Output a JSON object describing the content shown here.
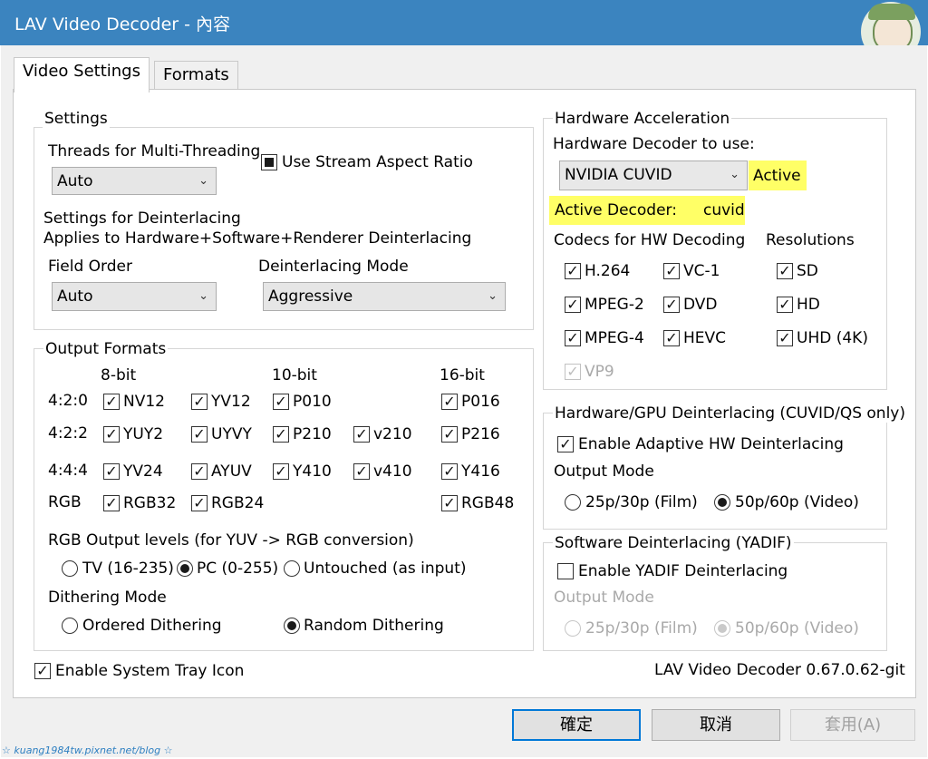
{
  "window": {
    "title": "LAV Video Decoder - 內容"
  },
  "tabs": [
    {
      "label": "Video Settings"
    },
    {
      "label": "Formats"
    }
  ],
  "settings": {
    "group_title": "Settings",
    "threads_label": "Threads for Multi-Threading",
    "threads_value": "Auto",
    "stream_aspect_label": "Use Stream Aspect Ratio",
    "deint_title": "Settings for Deinterlacing",
    "deint_desc": "Applies to Hardware+Software+Renderer Deinterlacing",
    "field_order_label": "Field Order",
    "field_order_value": "Auto",
    "deint_mode_label": "Deinterlacing Mode",
    "deint_mode_value": "Aggressive"
  },
  "output_formats": {
    "group_title": "Output Formats",
    "col_8bit": "8-bit",
    "col_10bit": "10-bit",
    "col_16bit": "16-bit",
    "rows": [
      "4:2:0",
      "4:2:2",
      "4:4:4",
      "RGB"
    ],
    "formats": {
      "nv12": "NV12",
      "yv12": "YV12",
      "p010": "P010",
      "p016": "P016",
      "yuy2": "YUY2",
      "uyvy": "UYVY",
      "p210": "P210",
      "v210": "v210",
      "p216": "P216",
      "yv24": "YV24",
      "ayuv": "AYUV",
      "y410": "Y410",
      "v410": "v410",
      "y416": "Y416",
      "rgb32": "RGB32",
      "rgb24": "RGB24",
      "rgb48": "RGB48"
    },
    "levels_label": "RGB Output levels (for YUV -> RGB conversion)",
    "levels": {
      "tv": "TV (16-235)",
      "pc": "PC (0-255)",
      "untouched": "Untouched (as input)"
    },
    "dither_label": "Dithering Mode",
    "dither": {
      "ordered": "Ordered Dithering",
      "random": "Random Dithering"
    }
  },
  "tray_label": "Enable System Tray Icon",
  "hw": {
    "group_title": "Hardware Acceleration",
    "decoder_label": "Hardware Decoder to use:",
    "decoder_value": "NVIDIA CUVID",
    "status": "Active",
    "active_decoder_label": "Active Decoder:",
    "active_decoder_value": "cuvid",
    "codecs_label": "Codecs for HW Decoding",
    "resolutions_label": "Resolutions",
    "codecs": {
      "h264": "H.264",
      "vc1": "VC-1",
      "mpeg2": "MPEG-2",
      "dvd": "DVD",
      "mpeg4": "MPEG-4",
      "hevc": "HEVC",
      "vp9": "VP9"
    },
    "resolutions": {
      "sd": "SD",
      "hd": "HD",
      "uhd": "UHD (4K)"
    }
  },
  "hw_deint": {
    "group_title": "Hardware/GPU Deinterlacing (CUVID/QS only)",
    "adaptive_label": "Enable Adaptive HW Deinterlacing",
    "output_mode_label": "Output Mode",
    "film": "25p/30p (Film)",
    "video": "50p/60p (Video)"
  },
  "sw_deint": {
    "group_title": "Software Deinterlacing (YADIF)",
    "yadif_label": "Enable YADIF Deinterlacing",
    "output_mode_label": "Output Mode",
    "film": "25p/30p (Film)",
    "video": "50p/60p (Video)"
  },
  "version": "LAV Video Decoder 0.67.0.62-git",
  "buttons": {
    "ok": "確定",
    "cancel": "取消",
    "apply": "套用(A)"
  },
  "watermark": "☆ kuang1984tw.pixnet.net/blog ☆",
  "colors": {
    "titlebar": "#3b84bf",
    "highlight": "#ffff66",
    "default_button_border": "#0078d7"
  }
}
